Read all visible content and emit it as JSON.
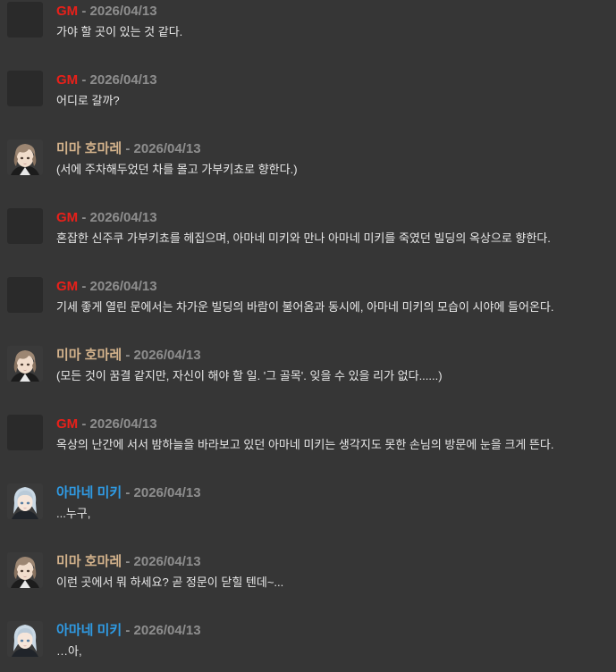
{
  "colors": {
    "background": "#363636",
    "gm": "#e8201a",
    "mima": "#d4b38c",
    "amane": "#2f9be4",
    "date": "#8e8e8e",
    "text": "#e8e8e8"
  },
  "messages": [
    {
      "speaker": "GM",
      "sep": " - ",
      "date": "2026/04/13",
      "text": "가야 할 곳이 있는 것 같다.",
      "avatar": "none"
    },
    {
      "speaker": "GM",
      "sep": " - ",
      "date": "2026/04/13",
      "text": "어디로 갈까?",
      "avatar": "none"
    },
    {
      "speaker": "미마 호마레",
      "sep": " - ",
      "date": "2026/04/13",
      "text": "(서에 주차해두었던 차를 몰고 가부키쵸로 향한다.)",
      "avatar": "mima-portrait"
    },
    {
      "speaker": "GM",
      "sep": " - ",
      "date": "2026/04/13",
      "text": "혼잡한 신주쿠 가부키쵸를 헤집으며, 아마네 미키와 만나 아마네 미키를 죽였던 빌딩의 옥상으로 향한다.",
      "avatar": "none"
    },
    {
      "speaker": "GM",
      "sep": " - ",
      "date": "2026/04/13",
      "text": "기세 좋게 열린 문에서는 차가운 빌딩의 바람이 불어옴과 동시에, 아마네 미키의 모습이 시야에 들어온다.",
      "avatar": "none"
    },
    {
      "speaker": "미마 호마레",
      "sep": " - ",
      "date": "2026/04/13",
      "text": "(모든 것이 꿈결 같지만, 자신이 해야 할 일. '그 골목'. 잊을 수 있을 리가 없다......)",
      "avatar": "mima-portrait"
    },
    {
      "speaker": "GM",
      "sep": " - ",
      "date": "2026/04/13",
      "text": "옥상의 난간에 서서 밤하늘을 바라보고 있던 아마네 미키는 생각지도 못한 손님의 방문에 눈을 크게 뜬다.",
      "avatar": "none"
    },
    {
      "speaker": "아마네 미키",
      "sep": " - ",
      "date": "2026/04/13",
      "text": "...누구,",
      "avatar": "amane-portrait"
    },
    {
      "speaker": "미마 호마레",
      "sep": " - ",
      "date": "2026/04/13",
      "text": "이런 곳에서 뭐 하세요? 곧 정문이 닫힐 텐데~...",
      "avatar": "mima-portrait"
    },
    {
      "speaker": "아마네 미키",
      "sep": " - ",
      "date": "2026/04/13",
      "text": "…아,",
      "avatar": "amane-portrait"
    }
  ]
}
